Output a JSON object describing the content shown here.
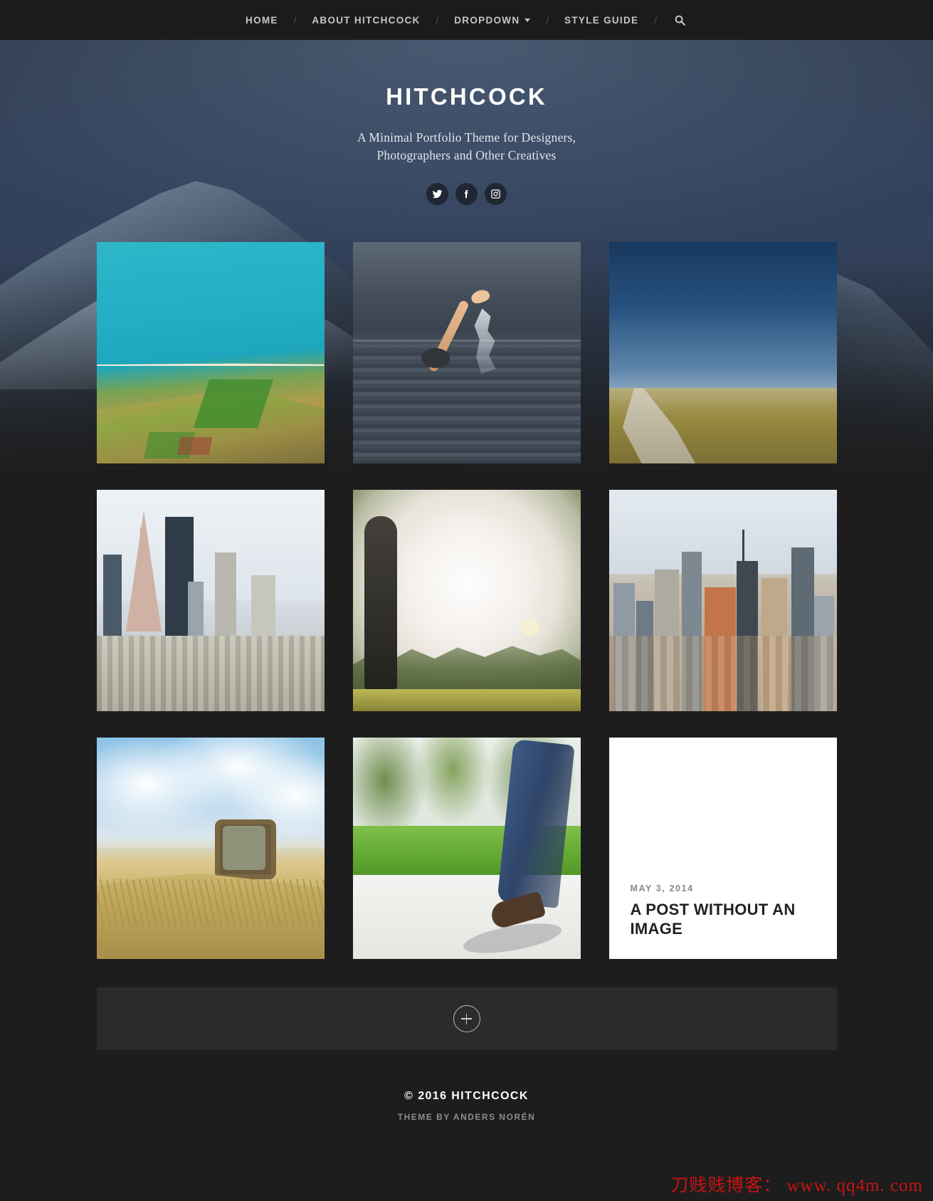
{
  "nav": {
    "items": [
      {
        "label": "HOME",
        "has_dropdown": false
      },
      {
        "label": "ABOUT HITCHCOCK",
        "has_dropdown": false
      },
      {
        "label": "DROPDOWN",
        "has_dropdown": true
      },
      {
        "label": "STYLE GUIDE",
        "has_dropdown": false
      }
    ],
    "separator": "/",
    "search_icon": "search-icon"
  },
  "hero": {
    "title": "HITCHCOCK",
    "tagline_line1": "A Minimal Portfolio Theme for Designers,",
    "tagline_line2": "Photographers and Other Creatives",
    "socials": [
      {
        "name": "twitter-icon",
        "glyph": "twitter"
      },
      {
        "name": "facebook-icon",
        "glyph": "facebook"
      },
      {
        "name": "instagram-icon",
        "glyph": "instagram"
      }
    ]
  },
  "grid": {
    "items": [
      {
        "kind": "image",
        "photo": "aerial-coastline"
      },
      {
        "kind": "image",
        "photo": "swimmer-in-lake"
      },
      {
        "kind": "image",
        "photo": "country-road-field"
      },
      {
        "kind": "image",
        "photo": "san-francisco-skyline"
      },
      {
        "kind": "image",
        "photo": "person-in-sunlight"
      },
      {
        "kind": "image",
        "photo": "new-york-skyline"
      },
      {
        "kind": "image",
        "photo": "old-tv-in-dune"
      },
      {
        "kind": "image",
        "photo": "walking-feet-on-path"
      },
      {
        "kind": "text",
        "date": "MAY 3, 2014",
        "title": "A POST WITHOUT AN IMAGE"
      }
    ]
  },
  "load_more": {
    "icon": "plus-icon",
    "label": ""
  },
  "footer": {
    "copyright": "© 2016 HITCHCOCK",
    "credit": "THEME BY ANDERS NORÉN"
  },
  "watermark": {
    "text": "刀贱贱博客： www. qq4m. com",
    "color": "#c81313"
  },
  "colors": {
    "page_bg": "#1d1d1d",
    "nav_bg": "#1b1b1b",
    "card_bg": "#2b2b2b",
    "accent_text": "#ffffff"
  }
}
